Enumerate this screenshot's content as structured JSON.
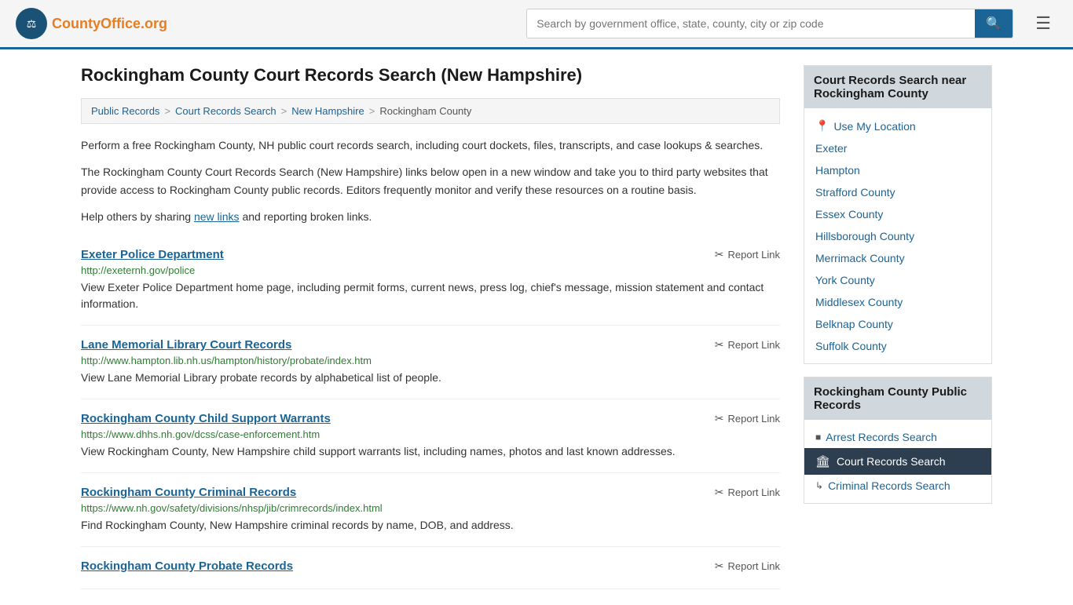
{
  "header": {
    "logo_text": "CountyOffice",
    "logo_domain": ".org",
    "search_placeholder": "Search by government office, state, county, city or zip code"
  },
  "page": {
    "title": "Rockingham County Court Records Search (New Hampshire)",
    "description_1": "Perform a free Rockingham County, NH public court records search, including court dockets, files, transcripts, and case lookups & searches.",
    "description_2": "The Rockingham County Court Records Search (New Hampshire) links below open in a new window and take you to third party websites that provide access to Rockingham County public records. Editors frequently monitor and verify these resources on a routine basis.",
    "description_3_pre": "Help others by sharing ",
    "description_3_link": "new links",
    "description_3_post": " and reporting broken links."
  },
  "breadcrumb": {
    "items": [
      "Public Records",
      "Court Records Search",
      "New Hampshire",
      "Rockingham County"
    ]
  },
  "records": [
    {
      "title": "Exeter Police Department",
      "url": "http://exeternh.gov/police",
      "desc": "View Exeter Police Department home page, including permit forms, current news, press log, chief's message, mission statement and contact information.",
      "report_label": "Report Link"
    },
    {
      "title": "Lane Memorial Library Court Records",
      "url": "http://www.hampton.lib.nh.us/hampton/history/probate/index.htm",
      "desc": "View Lane Memorial Library probate records by alphabetical list of people.",
      "report_label": "Report Link"
    },
    {
      "title": "Rockingham County Child Support Warrants",
      "url": "https://www.dhhs.nh.gov/dcss/case-enforcement.htm",
      "desc": "View Rockingham County, New Hampshire child support warrants list, including names, photos and last known addresses.",
      "report_label": "Report Link"
    },
    {
      "title": "Rockingham County Criminal Records",
      "url": "https://www.nh.gov/safety/divisions/nhsp/jib/crimrecords/index.html",
      "desc": "Find Rockingham County, New Hampshire criminal records by name, DOB, and address.",
      "report_label": "Report Link"
    },
    {
      "title": "Rockingham County Probate Records",
      "url": "",
      "desc": "",
      "report_label": "Report Link"
    }
  ],
  "sidebar": {
    "nearby_header": "Court Records Search near Rockingham County",
    "nearby_items": [
      {
        "label": "Use My Location",
        "type": "location"
      },
      {
        "label": "Exeter",
        "type": "link"
      },
      {
        "label": "Hampton",
        "type": "link"
      },
      {
        "label": "Strafford County",
        "type": "link"
      },
      {
        "label": "Essex County",
        "type": "link"
      },
      {
        "label": "Hillsborough County",
        "type": "link"
      },
      {
        "label": "Merrimack County",
        "type": "link"
      },
      {
        "label": "York County",
        "type": "link"
      },
      {
        "label": "Middlesex County",
        "type": "link"
      },
      {
        "label": "Belknap County",
        "type": "link"
      },
      {
        "label": "Suffolk County",
        "type": "link"
      }
    ],
    "public_records_header": "Rockingham County Public Records",
    "public_records_items": [
      {
        "label": "Arrest Records Search",
        "active": false,
        "icon": "■"
      },
      {
        "label": "Court Records Search",
        "active": true,
        "icon": "🏛"
      },
      {
        "label": "Criminal Records Search",
        "active": false,
        "icon": "↳"
      }
    ]
  }
}
